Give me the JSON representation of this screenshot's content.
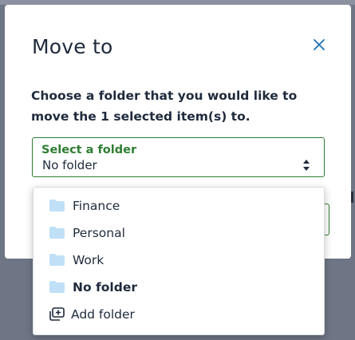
{
  "dialog": {
    "title": "Move to",
    "description": "Choose a folder that you would like to move the 1 selected item(s) to.",
    "close_icon": "close-icon"
  },
  "select": {
    "label": "Select a folder",
    "value": "No folder",
    "arrows_icon": "sort-arrows-icon"
  },
  "dropdown": {
    "options": [
      {
        "label": "Finance",
        "icon": "folder-icon",
        "selected": false
      },
      {
        "label": "Personal",
        "icon": "folder-icon",
        "selected": false
      },
      {
        "label": "Work",
        "icon": "folder-icon",
        "selected": false
      },
      {
        "label": "No folder",
        "icon": "folder-icon",
        "selected": true
      },
      {
        "label": "Add folder",
        "icon": "add-folder-icon",
        "selected": false
      }
    ]
  },
  "colors": {
    "accent": "#2e7d32",
    "text": "#1f2a3c",
    "folder": "#bfe0f7",
    "close": "#1f6fb2",
    "overlay": "#6e7585"
  }
}
